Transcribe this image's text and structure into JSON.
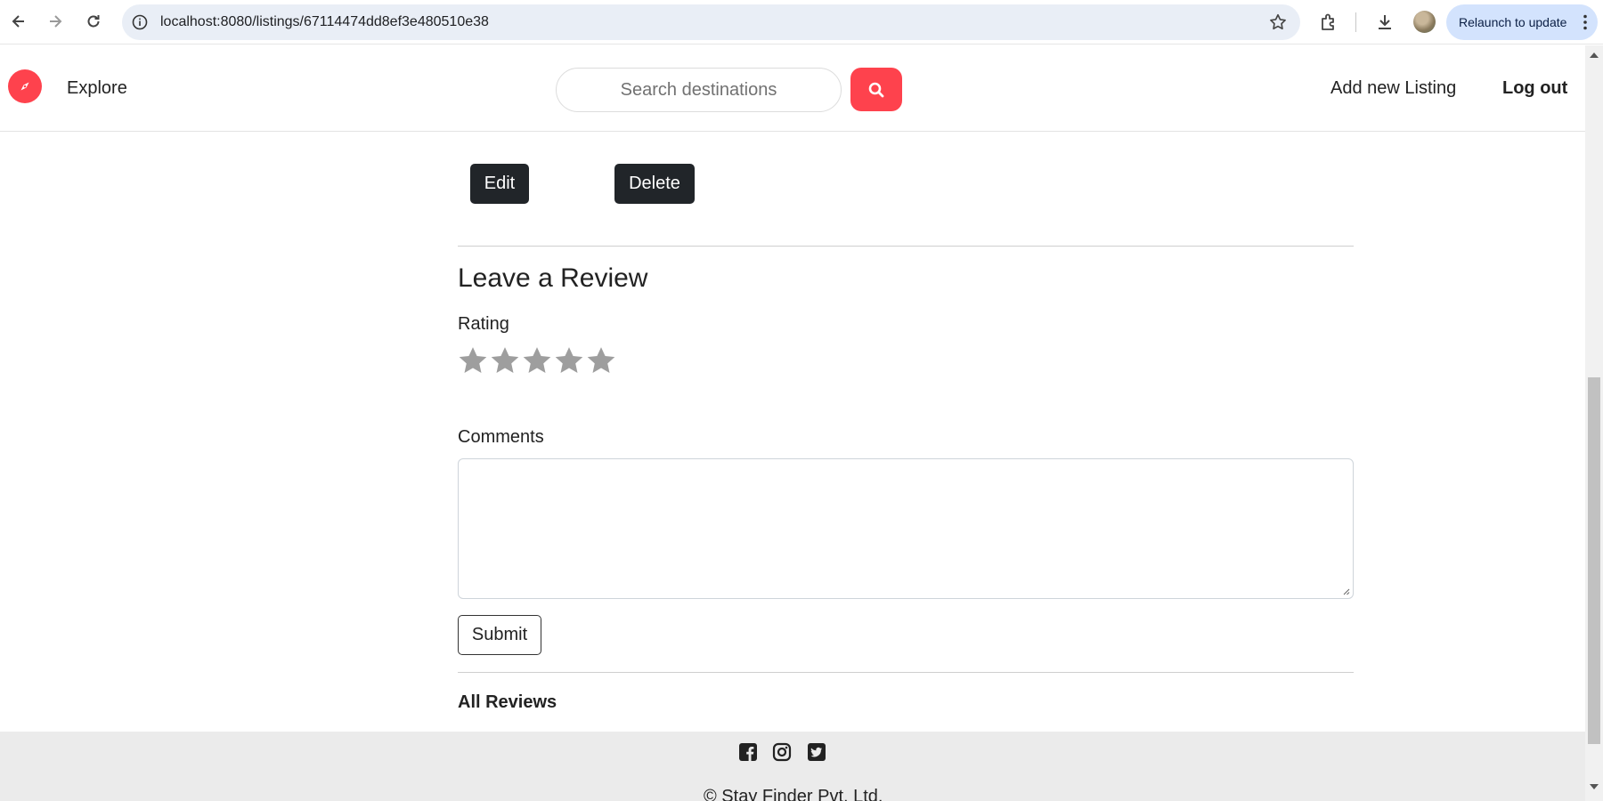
{
  "browser": {
    "url": "localhost:8080/listings/67114474dd8ef3e480510e38",
    "relaunch_label": "Relaunch to update"
  },
  "navbar": {
    "explore_label": "Explore",
    "search_placeholder": "Search destinations",
    "add_listing_label": "Add new Listing",
    "logout_label": "Log out",
    "accent_color": "#fe424d"
  },
  "actions": {
    "edit_label": "Edit",
    "delete_label": "Delete"
  },
  "review_form": {
    "heading": "Leave a Review",
    "rating_label": "Rating",
    "rating_value": 0,
    "rating_max": 5,
    "comments_label": "Comments",
    "comments_value": "",
    "submit_label": "Submit"
  },
  "reviews": {
    "heading": "All Reviews"
  },
  "footer": {
    "social_icons": [
      "facebook-icon",
      "instagram-icon",
      "twitter-icon"
    ],
    "copyright": "© Stay Finder Pvt. Ltd."
  }
}
